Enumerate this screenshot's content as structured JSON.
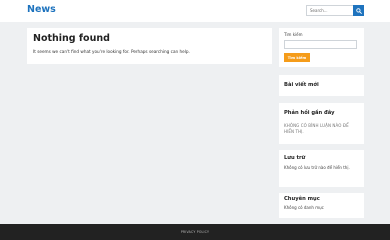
{
  "header": {
    "logo": "News",
    "search_placeholder": "Search..."
  },
  "main": {
    "title": "Nothing found",
    "text": "It seems we can't find what you're looking for. Perhaps searching can help."
  },
  "sidebar": {
    "search": {
      "label": "Tìm kiếm",
      "button": "Tìm kiếm"
    },
    "recent_posts": {
      "title": "Bài viết mới"
    },
    "recent_comments": {
      "title": "Phản hồi gần đây",
      "text": "KHÔNG CÓ BÌNH LUẬN NÀO ĐỂ HIỂN THỊ."
    },
    "archives": {
      "title": "Lưu trữ",
      "text": "Không có lưu trữ nào để hiển thị."
    },
    "categories": {
      "title": "Chuyên mục",
      "text": "Không có danh mục"
    }
  },
  "footer": {
    "link": "PRIVACY POLICY"
  },
  "colors": {
    "accent": "#1e73be",
    "button": "#f59c1a",
    "background": "#eef0f2",
    "footer": "#222222"
  }
}
